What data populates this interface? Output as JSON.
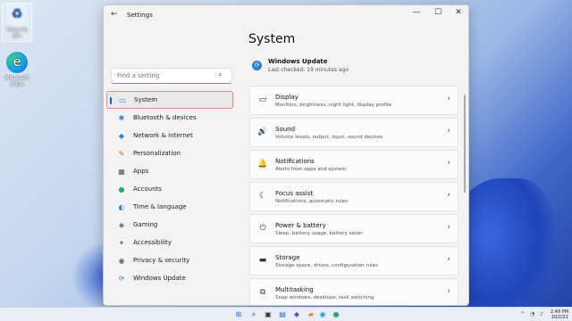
{
  "desktop": {
    "icons": [
      {
        "label": "Recycle Bin",
        "glyph": "♻"
      },
      {
        "label": "Microsoft Edge",
        "glyph": "e"
      }
    ]
  },
  "window": {
    "title": "Settings",
    "back_glyph": "←",
    "controls": {
      "minimize": "—",
      "maximize": "☐",
      "close": "✕"
    }
  },
  "search": {
    "placeholder": "Find a setting",
    "icon": "search-icon"
  },
  "nav": {
    "items": [
      {
        "label": "System",
        "icon": "▭",
        "active": true
      },
      {
        "label": "Bluetooth & devices",
        "icon": "✱"
      },
      {
        "label": "Network & internet",
        "icon": "◆"
      },
      {
        "label": "Personalization",
        "icon": "✎"
      },
      {
        "label": "Apps",
        "icon": "▦"
      },
      {
        "label": "Accounts",
        "icon": "●"
      },
      {
        "label": "Time & language",
        "icon": "◐"
      },
      {
        "label": "Gaming",
        "icon": "◈"
      },
      {
        "label": "Accessibility",
        "icon": "✦"
      },
      {
        "label": "Privacy & security",
        "icon": "◉"
      },
      {
        "label": "Windows Update",
        "icon": "⟳"
      }
    ]
  },
  "page": {
    "title": "System",
    "update": {
      "title": "Windows Update",
      "subtitle": "Last checked: 19 minutes ago"
    }
  },
  "cards": [
    {
      "title": "Display",
      "subtitle": "Monitors, brightness, night light, display profile",
      "icon": "▭"
    },
    {
      "title": "Sound",
      "subtitle": "Volume levels, output, input, sound devices",
      "icon": "🔊"
    },
    {
      "title": "Notifications",
      "subtitle": "Alerts from apps and system",
      "icon": "🔔"
    },
    {
      "title": "Focus assist",
      "subtitle": "Notifications, automatic rules",
      "icon": "☾"
    },
    {
      "title": "Power & battery",
      "subtitle": "Sleep, battery usage, battery saver",
      "icon": "⏻"
    },
    {
      "title": "Storage",
      "subtitle": "Storage space, drives, configuration rules",
      "icon": "▬"
    },
    {
      "title": "Multitasking",
      "subtitle": "Snap windows, desktops, task switching",
      "icon": "⧉"
    }
  ],
  "taskbar": {
    "time": "2:49 PM",
    "date": "10/2/21"
  },
  "colors": {
    "accent": "#0067c0",
    "active_outline": "#e08a8a"
  }
}
